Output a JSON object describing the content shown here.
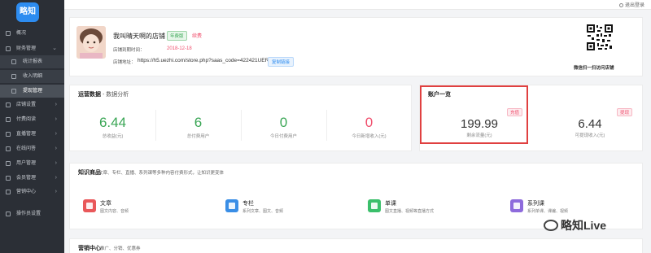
{
  "logo": {
    "text": "略知"
  },
  "sidebar": {
    "items": [
      {
        "label": "概况",
        "arrow": ""
      },
      {
        "label": "财务管理",
        "arrow": "⌄"
      },
      {
        "label": "统计报表",
        "arrow": ""
      },
      {
        "label": "收入明细",
        "arrow": ""
      },
      {
        "label": "提现管理",
        "arrow": ""
      },
      {
        "label": "店铺设置",
        "arrow": "›"
      },
      {
        "label": "付费阅读",
        "arrow": "›"
      },
      {
        "label": "直播管理",
        "arrow": "›"
      },
      {
        "label": "在线问答",
        "arrow": "›"
      },
      {
        "label": "用户管理",
        "arrow": "›"
      },
      {
        "label": "会员管理",
        "arrow": "›"
      },
      {
        "label": "营销中心",
        "arrow": "›"
      },
      {
        "label": "操作员设置",
        "arrow": ""
      }
    ]
  },
  "topbar": {
    "logout_label": "退出登录"
  },
  "store": {
    "name": "我叫晴天啊的店铺",
    "tag": "年费版",
    "renew_label": "续费",
    "expire_label": "店铺到期时间：",
    "expire_date": "2018-12-18",
    "url_label": "店铺地址：",
    "url": "https://h5.uezhi.com/store.php?saas_code=422421UER",
    "copy_label": "复制链接",
    "qr_caption": "微信扫一扫访问店铺"
  },
  "ops": {
    "title": "运营数据",
    "subtitle": "- 数据分析",
    "stats": [
      {
        "value": "6.44",
        "label": "总收益(元)"
      },
      {
        "value": "6",
        "label": "总付费用户"
      },
      {
        "value": "0",
        "label": "今日付费用户"
      },
      {
        "value": "0",
        "label": "今日新增收入(元)"
      }
    ]
  },
  "account": {
    "title": "账户一览",
    "balance": {
      "value": "199.99",
      "label": "剩余流量(元)",
      "button": "充值"
    },
    "withdraw": {
      "value": "6.44",
      "label": "可提现收入(元)",
      "button": "提现"
    }
  },
  "knowledge": {
    "title": "知识商品",
    "subtitle": "文章、专栏、直播、系列课等多种内容付费形式，让知识更变体",
    "products": [
      {
        "name": "文章",
        "desc": "图文内容、音频",
        "color": "#e9585a"
      },
      {
        "name": "专栏",
        "desc": "系列文章、图文、音频",
        "color": "#3a8ee6"
      },
      {
        "name": "单课",
        "desc": "图文直播、视频等直播方式",
        "color": "#3bbf6b"
      },
      {
        "name": "系列课",
        "desc": "系列单课、课编、视频",
        "color": "#8e6bdc"
      }
    ]
  },
  "marketing": {
    "title": "营销中心",
    "subtitle": "推广、分销、优惠券"
  },
  "watermark": {
    "text": "略知Live"
  }
}
